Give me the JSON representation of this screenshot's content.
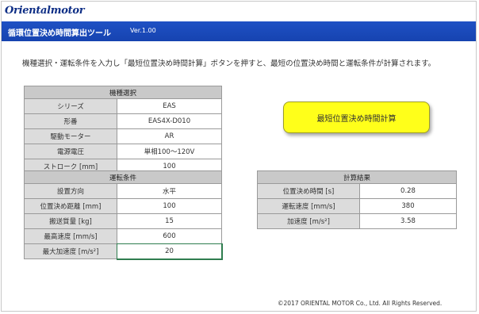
{
  "app": {
    "logo": "Orientalmotor",
    "title": "循環位置決め時間算出ツール",
    "version": "Ver.1.00"
  },
  "instructions": "機種選択・運転条件を入力し「最短位置決め時間計算」ボタンを押すと、最短の位置決め時間と運転条件が計算されます。",
  "model_selection": {
    "header": "機種選択",
    "rows": [
      {
        "label": "シリーズ",
        "value": "EAS"
      },
      {
        "label": "形番",
        "value": "EAS4X-D010"
      },
      {
        "label": "駆動モーター",
        "value": "AR"
      },
      {
        "label": "電源電圧",
        "value": "単相100～120V"
      },
      {
        "label": "ストローク [mm]",
        "value": "100"
      }
    ]
  },
  "operating_conditions": {
    "header": "運転条件",
    "rows": [
      {
        "label": "設置方向",
        "value": "水平"
      },
      {
        "label": "位置決め距離 [mm]",
        "value": "100"
      },
      {
        "label": "搬送質量 [kg]",
        "value": "15"
      },
      {
        "label": "最高速度 [mm/s]",
        "value": "600"
      },
      {
        "label": "最大加速度 [m/s²]",
        "value": "20"
      }
    ]
  },
  "results": {
    "header": "計算結果",
    "rows": [
      {
        "label": "位置決め時間 [s]",
        "value": "0.28"
      },
      {
        "label": "運転速度 [mm/s]",
        "value": "380"
      },
      {
        "label": "加速度 [m/s²]",
        "value": "3.58"
      }
    ]
  },
  "calc_button_label": "最短位置決め時間計算",
  "footer": "©2017 ORIENTAL MOTOR Co., Ltd. All Rights Reserved."
}
